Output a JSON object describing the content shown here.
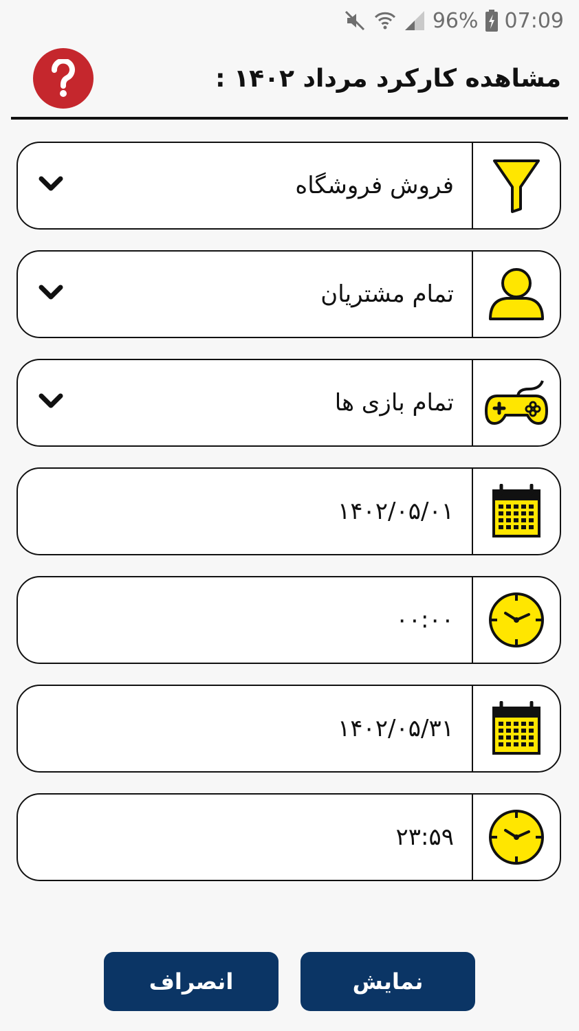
{
  "status_bar": {
    "battery": "96%",
    "time": "07:09"
  },
  "header": {
    "title": "مشاهده کارکرد مرداد ۱۴۰۲ :",
    "help_symbol": "?"
  },
  "filters": [
    {
      "icon": "funnel-icon",
      "value": "فروش فروشگاه",
      "dropdown": true
    },
    {
      "icon": "user-icon",
      "value": "تمام مشتریان",
      "dropdown": true
    },
    {
      "icon": "gamepad-icon",
      "value": "تمام بازی ها",
      "dropdown": true
    },
    {
      "icon": "calendar-icon",
      "value": "۱۴۰۲/۰۵/۰۱",
      "dropdown": false
    },
    {
      "icon": "clock-icon",
      "value": "۰۰:۰۰",
      "dropdown": false
    },
    {
      "icon": "calendar-icon",
      "value": "۱۴۰۲/۰۵/۳۱",
      "dropdown": false
    },
    {
      "icon": "clock-icon",
      "value": "۲۳:۵۹",
      "dropdown": false
    }
  ],
  "buttons": {
    "show_label": "نمایش",
    "cancel_label": "انصراف"
  },
  "colors": {
    "icon_yellow": "#ffe600",
    "button_navy": "#0b3565",
    "help_red": "#c5272d"
  }
}
